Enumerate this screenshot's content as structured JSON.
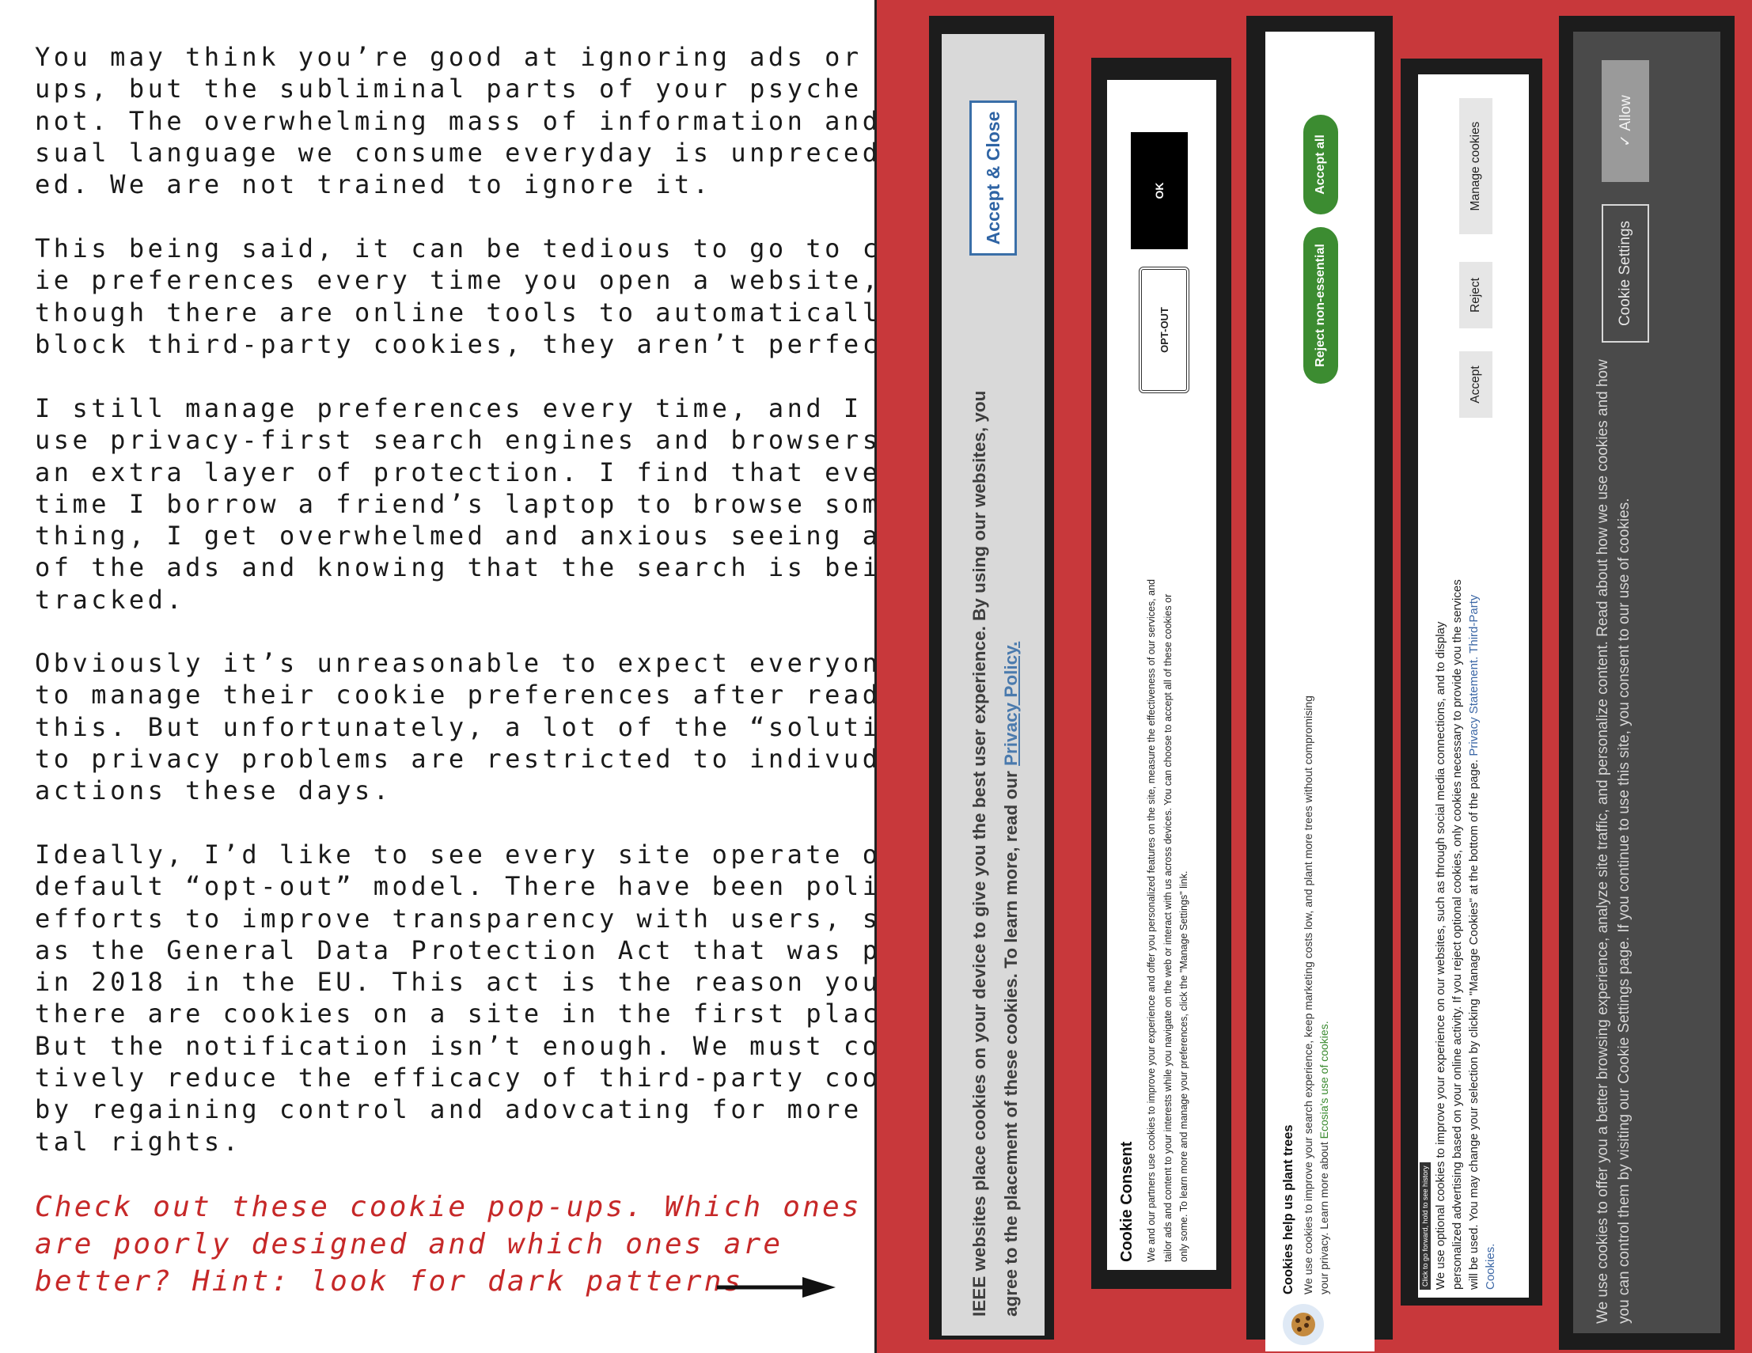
{
  "article": {
    "paragraphs": [
      "You may think you’re good at ignoring ads or pop-\nups, but the subliminal parts of your psyche are\nnot. The overwhelming mass of information and vi-\nsual language we consume everyday is unprecedent-\ned. We are not trained to ignore it.",
      "This being said, it can be tedious to go to cook-\nie preferences every time you open a website, and\nthough there are online tools to automatically\nblock third-party cookies, they aren’t perfect.",
      "I still manage preferences every time, and I also\nuse privacy-first search engines and browsers for\nan extra layer of protection. I find that every\ntime I borrow a friend’s laptop to browse some-\nthing, I get overwhelmed and anxious seeing all\nof the ads and knowing that the search is being\ntracked.",
      "Obviously it’s unreasonable to expect everyone\nto manage their cookie preferences after reading\nthis. But unfortunately, a lot of the “solutions”\nto privacy problems are restricted to indivudal\nactions these days.",
      "Ideally, I’d like to see every site operate on a\ndefault “opt-out” model. There have been policy\nefforts to improve transparency with users, such\nas the General Data Protection Act that was passed\nin 2018 in the EU. This act is the reason you know\nthere are cookies on a site in the first place.\nBut the notification isn’t enough. We must collec-\ntively reduce the efficacy of third-party cookies\nby regaining control and adovcating for more digi-\ntal rights."
    ],
    "call_to_action": "Check out these cookie pop-ups. Which ones\nare poorly designed and which ones are\nbetter? Hint: look for dark patterns"
  },
  "popups": {
    "ieee": {
      "text_before_link": "IEEE websites place cookies on your device to give you the best user experience. By using our websites, you agree to the placement of these cookies. To learn more, read our",
      "link": "Privacy Policy.",
      "button": "Accept & Close"
    },
    "consent": {
      "title": "Cookie Consent",
      "body": "We and our partners use cookies to improve your experience and offer you personalized features on the site, measure the effectiveness of our services, and tailor ads and content to your interests while you navigate on the web or interact with us across devices. You can choose to accept all of these cookies or only some. To learn more and manage your preferences, click the \"Manage Settings\" link.",
      "opt_out": "OPT-OUT",
      "ok": "OK"
    },
    "ecosia": {
      "title": "Cookies help us plant trees",
      "body": "We use cookies to improve your search experience, keep marketing costs low, and plant more trees without compromising your privacy. Learn more about",
      "link": "Ecosia's use of cookies.",
      "reject": "Reject non-essential",
      "accept": "Accept all"
    },
    "manage": {
      "hint": "Click to go forward, hold to see history",
      "body": "We use optional cookies to improve your experience on our websites, such as through social media connections, and to display personalized advertising based on your online activity. If you reject optional cookies, only cookies necessary to provide you the services will be used. You may change your selection by clicking \"Manage Cookies\" at the bottom of the page.",
      "link1": "Privacy Statement.",
      "link2": "Third-Party Cookies.",
      "accept": "Accept",
      "reject": "Reject",
      "manage": "Manage cookies"
    },
    "dark": {
      "body": "We use cookies to offer you a better browsing experience, analyze site traffic, and personalize content. Read about how we use cookies and how you can control them by visiting our Cookie Settings page. If you continue to use this site, you consent to our use of cookies.",
      "settings": "Cookie Settings",
      "allow": "✓ Allow"
    }
  },
  "colors": {
    "panel_background": "#c8383b",
    "call_to_action": "#c62828",
    "ecosia_green": "#3c8c31",
    "ieee_blue": "#2f64a4"
  }
}
